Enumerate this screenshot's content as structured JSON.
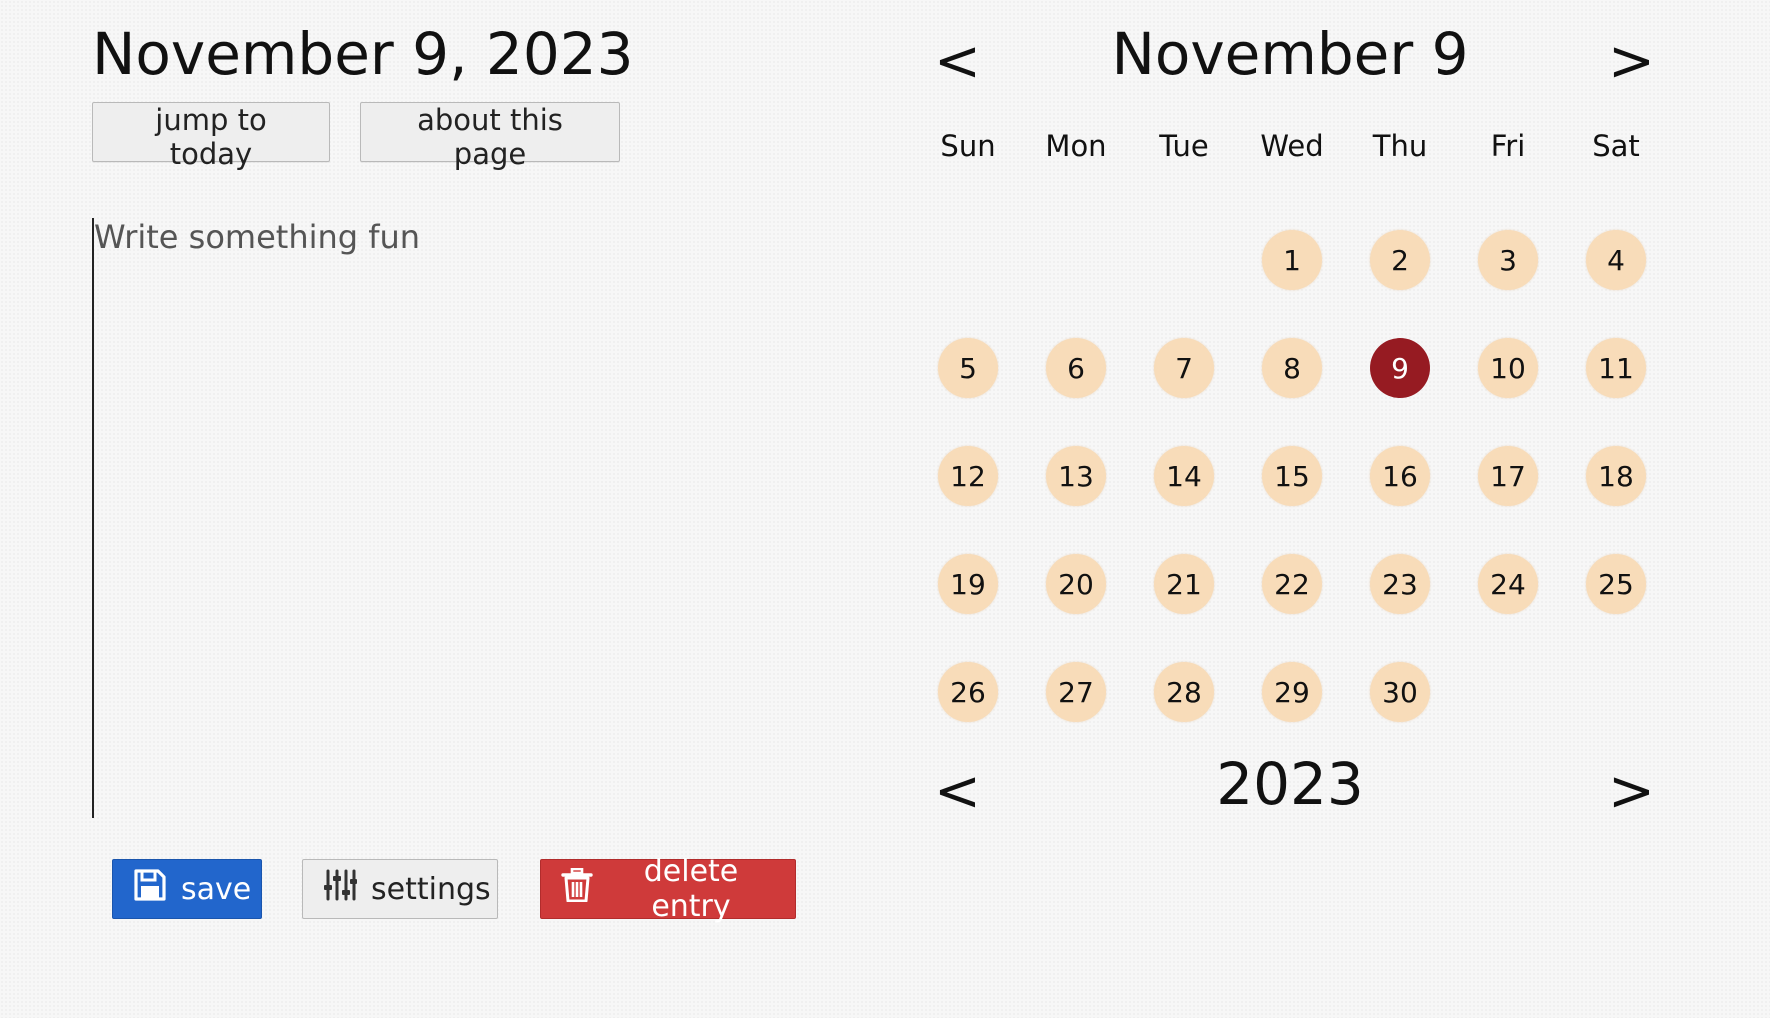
{
  "header": {
    "date_title": "November 9, 2023",
    "jump_to_today_label": "jump to today",
    "about_label": "about this page"
  },
  "editor": {
    "placeholder": "Write something fun",
    "value": ""
  },
  "actions": {
    "save_label": "save",
    "settings_label": "settings",
    "delete_label": "delete entry",
    "save_icon": "floppy-disk-icon",
    "settings_icon": "sliders-icon",
    "delete_icon": "trash-icon"
  },
  "calendar": {
    "prev_symbol": "<",
    "next_symbol": ">",
    "month_title": "November 9",
    "year_title": "2023",
    "weekdays": [
      "Sun",
      "Mon",
      "Tue",
      "Wed",
      "Thu",
      "Fri",
      "Sat"
    ],
    "first_weekday_index": 3,
    "days_in_month": 30,
    "selected_day": 9,
    "colors": {
      "day_bg": "#f8dcb9",
      "selected_bg": "#961b22",
      "save_bg": "#2266cc",
      "delete_bg": "#cf3a3a"
    }
  }
}
